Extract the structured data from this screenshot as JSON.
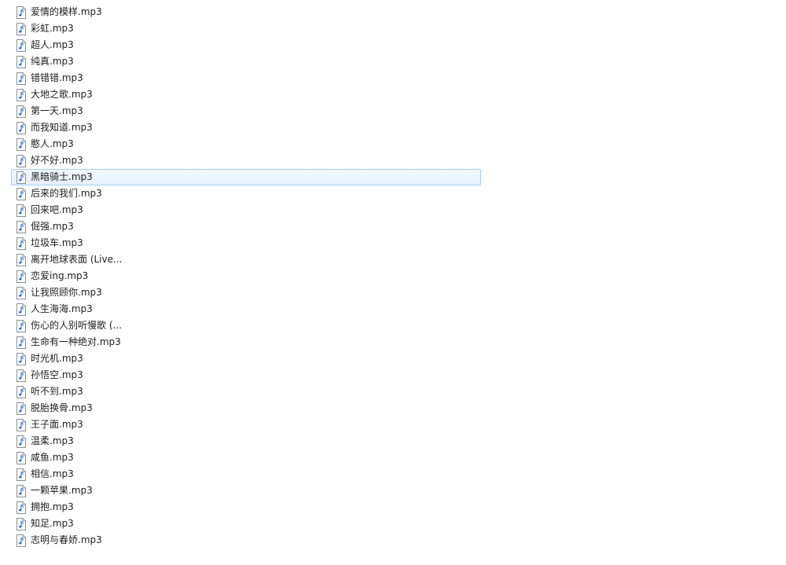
{
  "files": [
    {
      "name": "爱情的模样.mp3",
      "selected": false
    },
    {
      "name": "彩虹.mp3",
      "selected": false
    },
    {
      "name": "超人.mp3",
      "selected": false
    },
    {
      "name": "纯真.mp3",
      "selected": false
    },
    {
      "name": "错错错.mp3",
      "selected": false
    },
    {
      "name": "大地之歌.mp3",
      "selected": false
    },
    {
      "name": "第一天.mp3",
      "selected": false
    },
    {
      "name": "而我知道.mp3",
      "selected": false
    },
    {
      "name": "憨人.mp3",
      "selected": false
    },
    {
      "name": "好不好.mp3",
      "selected": false
    },
    {
      "name": "黑暗骑士.mp3",
      "selected": true
    },
    {
      "name": "后来的我们.mp3",
      "selected": false
    },
    {
      "name": "回来吧.mp3",
      "selected": false
    },
    {
      "name": "倔强.mp3",
      "selected": false
    },
    {
      "name": "垃圾车.mp3",
      "selected": false
    },
    {
      "name": "离开地球表面 (Live...",
      "selected": false
    },
    {
      "name": "恋爱ing.mp3",
      "selected": false
    },
    {
      "name": "让我照顾你.mp3",
      "selected": false
    },
    {
      "name": "人生海海.mp3",
      "selected": false
    },
    {
      "name": "伤心的人别听慢歌 (...",
      "selected": false
    },
    {
      "name": "生命有一种绝对.mp3",
      "selected": false
    },
    {
      "name": "时光机.mp3",
      "selected": false
    },
    {
      "name": "孙悟空.mp3",
      "selected": false
    },
    {
      "name": "听不到.mp3",
      "selected": false
    },
    {
      "name": "脱胎换骨.mp3",
      "selected": false
    },
    {
      "name": "王子面.mp3",
      "selected": false
    },
    {
      "name": "温柔.mp3",
      "selected": false
    },
    {
      "name": "咸鱼.mp3",
      "selected": false
    },
    {
      "name": "相信.mp3",
      "selected": false
    },
    {
      "name": "一颗苹果.mp3",
      "selected": false
    },
    {
      "name": "拥抱.mp3",
      "selected": false
    },
    {
      "name": "知足.mp3",
      "selected": false
    },
    {
      "name": "志明与春娇.mp3",
      "selected": false
    }
  ],
  "icon": "audio-file-icon"
}
